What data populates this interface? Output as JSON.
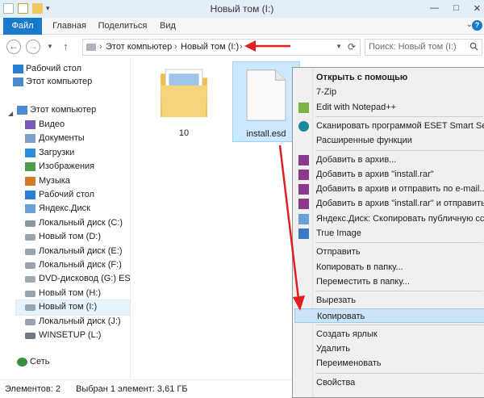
{
  "window": {
    "title": "Новый том (I:)",
    "controls": [
      "—",
      "□",
      "✕"
    ]
  },
  "ribbon": {
    "tabs": [
      "Файл",
      "Главная",
      "Поделиться",
      "Вид"
    ]
  },
  "address": {
    "crumbs": [
      "Этот компьютер",
      "Новый том (I:)"
    ],
    "separator": "›",
    "search_placeholder": "Поиск: Новый том (I:)"
  },
  "sidebar": {
    "favorites": [
      {
        "label": "Рабочий стол",
        "icon": "desktop-icon"
      },
      {
        "label": "Этот компьютер",
        "icon": "computer-icon"
      }
    ],
    "computer_group": {
      "label": "Этот компьютер",
      "icon": "computer-icon"
    },
    "items": [
      {
        "label": "Видео",
        "icon": "video-folder-icon"
      },
      {
        "label": "Документы",
        "icon": "documents-folder-icon"
      },
      {
        "label": "Загрузки",
        "icon": "downloads-folder-icon"
      },
      {
        "label": "Изображения",
        "icon": "pictures-folder-icon"
      },
      {
        "label": "Музыка",
        "icon": "music-folder-icon"
      },
      {
        "label": "Рабочий стол",
        "icon": "desktop-folder-icon"
      },
      {
        "label": "Яндекс.Диск",
        "icon": "yandex-disk-icon"
      },
      {
        "label": "Локальный диск (C:)",
        "icon": "system-drive-icon"
      },
      {
        "label": "Новый том (D:)",
        "icon": "drive-icon"
      },
      {
        "label": "Локальный диск (E:)",
        "icon": "drive-icon"
      },
      {
        "label": "Локальный диск (F:)",
        "icon": "drive-icon"
      },
      {
        "label": "DVD-дисковод (G:) ESD-",
        "icon": "dvd-drive-icon"
      },
      {
        "label": "Новый том (H:)",
        "icon": "drive-icon"
      },
      {
        "label": "Новый том (I:)",
        "icon": "drive-icon",
        "selected": true
      },
      {
        "label": "Локальный диск (J:)",
        "icon": "drive-icon"
      },
      {
        "label": "WINSETUP (L:)",
        "icon": "usb-drive-icon"
      }
    ],
    "network": {
      "label": "Сеть",
      "icon": "network-icon"
    }
  },
  "files": [
    {
      "name": "10",
      "icon": "folder-icon"
    },
    {
      "name": "install.esd",
      "icon": "file-icon",
      "selected": true
    }
  ],
  "status": {
    "count": "Элементов: 2",
    "selection": "Выбран 1 элемент: 3,61 ГБ"
  },
  "context_menu": {
    "items": [
      {
        "label": "Открыть с помощью",
        "bold": true
      },
      {
        "label": "7-Zip"
      },
      {
        "label": "Edit with Notepad++",
        "icon": "notepadpp-icon"
      },
      {
        "sep": true
      },
      {
        "label": "Сканировать программой ESET Smart Security",
        "icon": "eset-icon"
      },
      {
        "label": "Расширенные функции"
      },
      {
        "sep": true
      },
      {
        "label": "Добавить в архив...",
        "icon": "winrar-icon"
      },
      {
        "label": "Добавить в архив \"install.rar\"",
        "icon": "winrar-icon"
      },
      {
        "label": "Добавить в архив и отправить по e-mail...",
        "icon": "winrar-icon"
      },
      {
        "label": "Добавить в архив \"install.rar\" и отправить по e",
        "icon": "winrar-icon"
      },
      {
        "label": "Яндекс.Диск: Скопировать публичную ссылку",
        "icon": "yandex-disk-icon"
      },
      {
        "label": "True Image",
        "icon": "true-image-icon"
      },
      {
        "sep": true
      },
      {
        "label": "Отправить"
      },
      {
        "label": "Копировать в папку..."
      },
      {
        "label": "Переместить в папку..."
      },
      {
        "sep": true
      },
      {
        "label": "Вырезать"
      },
      {
        "label": "Копировать",
        "highlight": true
      },
      {
        "sep": true
      },
      {
        "label": "Создать ярлык"
      },
      {
        "label": "Удалить"
      },
      {
        "label": "Переименовать"
      },
      {
        "sep": true
      },
      {
        "label": "Свойства"
      }
    ]
  },
  "colors": {
    "accent": "#1979ca",
    "selection": "#cce8ff",
    "annotation_arrow": "#e02020",
    "menu_highlight": "#cbe3f7"
  }
}
